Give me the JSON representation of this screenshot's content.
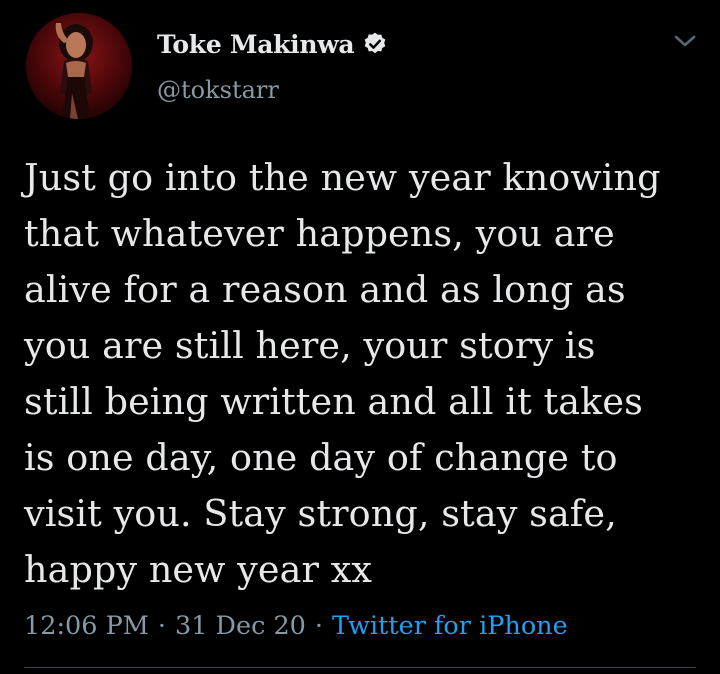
{
  "author": {
    "display_name": "Toke Makinwa",
    "handle": "@tokstarr",
    "verified": true
  },
  "tweet": {
    "text": "Just go into the new year knowing\nthat whatever happens, you are\nalive for a reason and as long as\nyou are still here, your story is\nstill being written and all it takes\nis one day, one day of change to\nvisit you. Stay strong, stay safe,\nhappy new year xx",
    "time": "12:06 PM",
    "date": "31 Dec 20",
    "source": "Twitter for iPhone",
    "separator": "·"
  },
  "icons": {
    "verified": "verified-badge-icon",
    "menu": "chevron-down-icon"
  },
  "colors": {
    "background": "#000000",
    "text": "#e6e8ea",
    "secondary_text": "#8899a6",
    "link": "#1da1f2",
    "divider": "#38444d"
  }
}
